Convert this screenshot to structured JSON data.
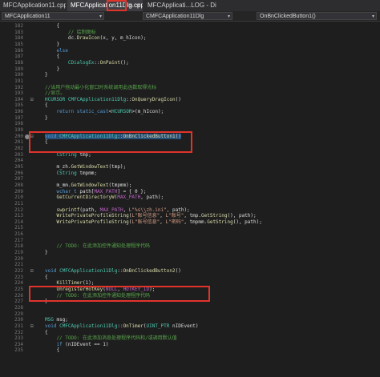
{
  "tabs": [
    {
      "label": "MFCApplication11.cpp"
    },
    {
      "label": "MFCApplication11Dlg.cpp"
    },
    {
      "label": "MFCApplicati...LOG - Dialog"
    }
  ],
  "nav": {
    "project": "MFCApplication11",
    "class": "CMFCApplication11Dlg",
    "member": "OnBnClickedButton1()"
  },
  "lines": [
    {
      "n": "182",
      "t": "    {"
    },
    {
      "n": "183",
      "t": "        // 绘制图标"
    },
    {
      "n": "184",
      "t": "        dc.DrawIcon(x, y, m_hIcon);"
    },
    {
      "n": "185",
      "t": "    }"
    },
    {
      "n": "186",
      "t": "    else"
    },
    {
      "n": "187",
      "t": "    {"
    },
    {
      "n": "188",
      "t": "        CDialogEx::OnPaint();"
    },
    {
      "n": "189",
      "t": "    }"
    },
    {
      "n": "190",
      "t": "}"
    },
    {
      "n": "191",
      "t": ""
    },
    {
      "n": "192",
      "t": "//当用户拖动最小化窗口时系统调用此函数取得光标"
    },
    {
      "n": "193",
      "t": "//显示。"
    },
    {
      "n": "194",
      "t": "HCURSOR CMFCApplication11Dlg::OnQueryDragIcon()"
    },
    {
      "n": "195",
      "t": "{"
    },
    {
      "n": "196",
      "t": "    return static_cast<HCURSOR>(m_hIcon);"
    },
    {
      "n": "197",
      "t": "}"
    },
    {
      "n": "198",
      "t": ""
    },
    {
      "n": "199",
      "t": ""
    },
    {
      "n": "200",
      "t": "void CMFCApplication11Dlg::OnBnClickedButton1()"
    },
    {
      "n": "201",
      "t": "{"
    },
    {
      "n": "202",
      "t": ""
    },
    {
      "n": "203",
      "t": "    CString tmp;"
    },
    {
      "n": "204",
      "t": ""
    },
    {
      "n": "205",
      "t": "    m_zh.GetWindowText(tmp);"
    },
    {
      "n": "206",
      "t": "    CString tmpmm;"
    },
    {
      "n": "207",
      "t": ""
    },
    {
      "n": "208",
      "t": "    m_mm.GetWindowText(tmpmm);"
    },
    {
      "n": "209",
      "t": "    wchar_t path[MAX_PATH] = { 0 };"
    },
    {
      "n": "210",
      "t": "    GetCurrentDirectoryW(MAX_PATH, path);"
    },
    {
      "n": "211",
      "t": ""
    },
    {
      "n": "212",
      "t": "    swprintf(path, MAX_PATH, L\"%s\\\\zh.ini\", path);"
    },
    {
      "n": "213",
      "t": "    WritePrivateProfileString(L\"账号信息\", L\"账号\", tmp.GetString(), path);"
    },
    {
      "n": "214",
      "t": "    WritePrivateProfileString(L\"账号信息\", L\"密码\", tmpmm.GetString(), path);"
    },
    {
      "n": "215",
      "t": ""
    },
    {
      "n": "216",
      "t": ""
    },
    {
      "n": "217",
      "t": ""
    },
    {
      "n": "218",
      "t": "    // TODO: 在此添加控件通知处理程序代码"
    },
    {
      "n": "219",
      "t": "}"
    },
    {
      "n": "220",
      "t": ""
    },
    {
      "n": "221",
      "t": ""
    },
    {
      "n": "222",
      "t": "void CMFCApplication11Dlg::OnBnClickedButton2()"
    },
    {
      "n": "223",
      "t": "{"
    },
    {
      "n": "224",
      "t": "    KillTimer(1);"
    },
    {
      "n": "225",
      "t": "    UnregisterHotKey(NULL, HOTKEY_ID);"
    },
    {
      "n": "226",
      "t": "    // TODO: 在此添加控件通知处理程序代码"
    },
    {
      "n": "227",
      "t": "}"
    },
    {
      "n": "228",
      "t": ""
    },
    {
      "n": "229",
      "t": ""
    },
    {
      "n": "230",
      "t": "MSG msg;"
    },
    {
      "n": "231",
      "t": "void CMFCApplication11Dlg::OnTimer(UINT_PTR nIDEvent)"
    },
    {
      "n": "232",
      "t": "{"
    },
    {
      "n": "233",
      "t": "    // TODO: 在此添加消息处理程序代码和/或调用默认值"
    },
    {
      "n": "234",
      "t": "    if (nIDEvent == 1)"
    },
    {
      "n": "235",
      "t": "    {"
    }
  ]
}
